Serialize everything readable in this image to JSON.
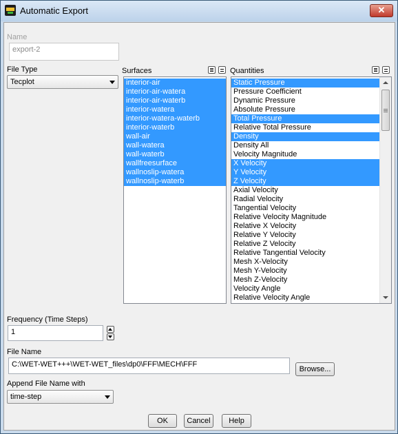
{
  "window": {
    "title": "Automatic Export",
    "close_glyph": "✕"
  },
  "name": {
    "label": "Name",
    "value": "export-2"
  },
  "file_type": {
    "label": "File Type",
    "selected": "Tecplot"
  },
  "surfaces": {
    "label": "Surfaces",
    "items": [
      {
        "label": "interior-air",
        "selected": true
      },
      {
        "label": "interior-air-watera",
        "selected": true
      },
      {
        "label": "interior-air-waterb",
        "selected": true
      },
      {
        "label": "interior-watera",
        "selected": true
      },
      {
        "label": "interior-watera-waterb",
        "selected": true
      },
      {
        "label": "interior-waterb",
        "selected": true
      },
      {
        "label": "wall-air",
        "selected": true
      },
      {
        "label": "wall-watera",
        "selected": true
      },
      {
        "label": "wall-waterb",
        "selected": true
      },
      {
        "label": "wallfreesurface",
        "selected": true
      },
      {
        "label": "wallnoslip-watera",
        "selected": true
      },
      {
        "label": "wallnoslip-waterb",
        "selected": true
      }
    ]
  },
  "quantities": {
    "label": "Quantities",
    "items": [
      {
        "label": "Static Pressure",
        "selected": true
      },
      {
        "label": "Pressure Coefficient",
        "selected": false
      },
      {
        "label": "Dynamic Pressure",
        "selected": false
      },
      {
        "label": "Absolute Pressure",
        "selected": false
      },
      {
        "label": "Total Pressure",
        "selected": true
      },
      {
        "label": "Relative Total Pressure",
        "selected": false
      },
      {
        "label": "Density",
        "selected": true
      },
      {
        "label": "Density All",
        "selected": false
      },
      {
        "label": "Velocity Magnitude",
        "selected": false
      },
      {
        "label": "X Velocity",
        "selected": true
      },
      {
        "label": "Y Velocity",
        "selected": true
      },
      {
        "label": "Z Velocity",
        "selected": true
      },
      {
        "label": "Axial Velocity",
        "selected": false
      },
      {
        "label": "Radial Velocity",
        "selected": false
      },
      {
        "label": "Tangential Velocity",
        "selected": false
      },
      {
        "label": "Relative Velocity Magnitude",
        "selected": false
      },
      {
        "label": "Relative X Velocity",
        "selected": false
      },
      {
        "label": "Relative Y Velocity",
        "selected": false
      },
      {
        "label": "Relative Z Velocity",
        "selected": false
      },
      {
        "label": "Relative Tangential Velocity",
        "selected": false
      },
      {
        "label": "Mesh X-Velocity",
        "selected": false
      },
      {
        "label": "Mesh Y-Velocity",
        "selected": false
      },
      {
        "label": "Mesh Z-Velocity",
        "selected": false
      },
      {
        "label": "Velocity Angle",
        "selected": false
      },
      {
        "label": "Relative Velocity Angle",
        "selected": false
      }
    ]
  },
  "frequency": {
    "label": "Frequency (Time Steps)",
    "value": "1"
  },
  "file_name": {
    "label": "File Name",
    "value": "C:\\WET-WET+++\\WET-WET_files\\dp0\\FFF\\MECH\\FFF",
    "browse_label": "Browse..."
  },
  "append": {
    "label": "Append File Name with",
    "selected": "time-step"
  },
  "buttons": {
    "ok": "OK",
    "cancel": "Cancel",
    "help": "Help"
  },
  "colors": {
    "selection": "#3399ff",
    "titlebar": "#c9daec",
    "close": "#c0392b"
  },
  "icons": {
    "app": "fluent-app-icon",
    "select_all": "select-all-icon",
    "deselect_all": "deselect-all-icon"
  }
}
